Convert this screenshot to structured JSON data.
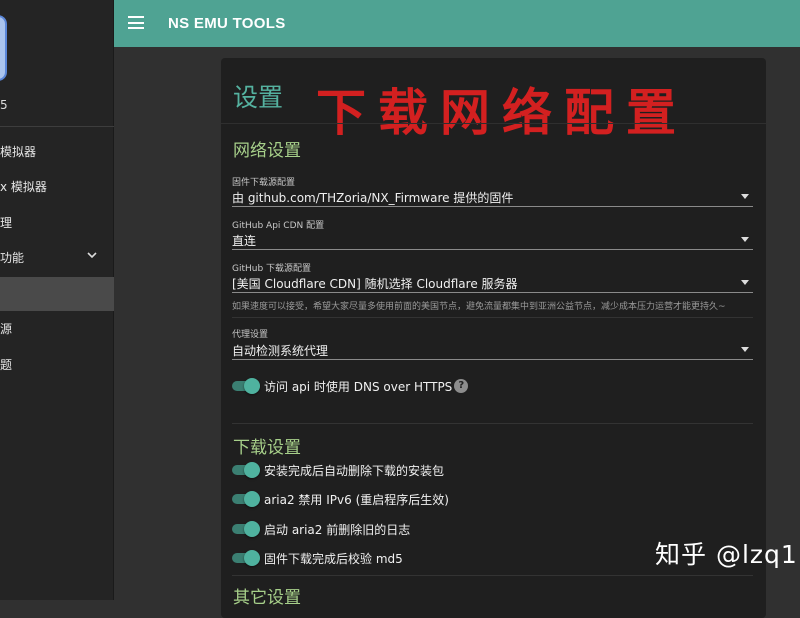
{
  "app": {
    "title": "NS EMU TOOLS"
  },
  "sidebar": {
    "version_fragment": "5",
    "items": [
      {
        "label": "模拟器"
      },
      {
        "label": "x 模拟器"
      },
      {
        "label": "理"
      },
      {
        "label": "功能"
      },
      {
        "label": ""
      },
      {
        "label": "源"
      },
      {
        "label": "题"
      }
    ]
  },
  "settings": {
    "title": "设置",
    "overlay_title": "下载网络配置",
    "network": {
      "title": "网络设置",
      "firmware_source": {
        "label": "固件下载源配置",
        "value": "由 github.com/THZoria/NX_Firmware 提供的固件"
      },
      "github_api_cdn": {
        "label": "GitHub Api CDN 配置",
        "value": "直连"
      },
      "github_download_source": {
        "label": "GitHub 下载源配置",
        "value": "[美国 Cloudflare CDN] 随机选择 Cloudflare 服务器"
      },
      "hint": "如果速度可以接受，希望大家尽量多使用前面的美国节点，避免流量都集中到亚洲公益节点，减少成本压力运营才能更持久~",
      "proxy": {
        "label": "代理设置",
        "value": "自动检测系统代理"
      },
      "dns_over_https": {
        "label": "访问 api 时使用 DNS over HTTPS",
        "on": true
      }
    },
    "download": {
      "title": "下载设置",
      "toggles": [
        {
          "label": "安装完成后自动删除下载的安装包",
          "on": true
        },
        {
          "label": "aria2 禁用 IPv6 (重启程序后生效)",
          "on": true
        },
        {
          "label": "启动 aria2 前删除旧的日志",
          "on": true
        },
        {
          "label": "固件下载完成后校验 md5",
          "on": true
        }
      ]
    },
    "other": {
      "title": "其它设置"
    }
  },
  "watermark": "知乎 @lzq1",
  "colors": {
    "topbar": "#4fa393",
    "accent": "#55b2a0",
    "section": "#a7d08a",
    "overlay": "#d32020"
  }
}
